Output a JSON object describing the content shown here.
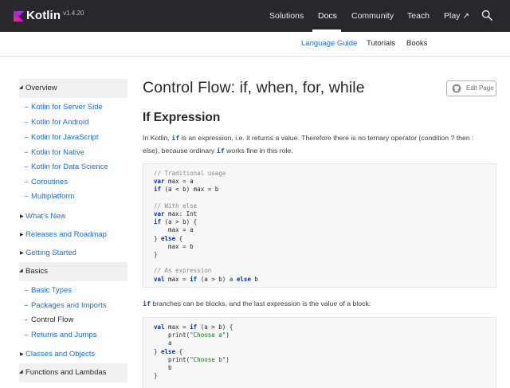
{
  "header": {
    "logo_text": "Kotlin",
    "version": "v1.4.20",
    "nav": [
      {
        "label": "Solutions"
      },
      {
        "label": "Docs"
      },
      {
        "label": "Community"
      },
      {
        "label": "Teach"
      },
      {
        "label": "Play ↗"
      }
    ],
    "active_nav": "Docs"
  },
  "subnav": {
    "items": [
      {
        "label": "Language Guide"
      },
      {
        "label": "Tutorials"
      },
      {
        "label": "Books"
      }
    ],
    "active": "Language Guide"
  },
  "sidebar": {
    "items": [
      {
        "label": "Overview"
      },
      {
        "label": "Kotlin for Server Side"
      },
      {
        "label": "Kotlin for Android"
      },
      {
        "label": "Kotlin for JavaScript"
      },
      {
        "label": "Kotlin for Native"
      },
      {
        "label": "Kotlin for Data Science"
      },
      {
        "label": "Coroutines"
      },
      {
        "label": "Multiplatform"
      },
      {
        "label": "What's New"
      },
      {
        "label": "Releases and Roadmap"
      },
      {
        "label": "Getting Started"
      },
      {
        "label": "Basics"
      },
      {
        "label": "Basic Types"
      },
      {
        "label": "Packages and Imports"
      },
      {
        "label": "Control Flow"
      },
      {
        "label": "Returns and Jumps"
      },
      {
        "label": "Classes and Objects"
      },
      {
        "label": "Functions and Lambdas"
      }
    ]
  },
  "main": {
    "title": "Control Flow: if, when, for, while",
    "edit_label": "Edit Page",
    "section_title": "If Expression",
    "intro": {
      "p1_a": "In Kotlin, ",
      "p1_code": "if",
      "p1_b": " is an expression, i.e. it returns a value. Therefore there is no ternary operator (condition ? then :",
      "p2_a": "else), because ordinary ",
      "p2_code": "if",
      "p2_b": " works fine in this role."
    },
    "blocks_para": {
      "code": "if",
      "text": " branches can be blocks, and the last expression is the value of a block:"
    }
  },
  "colors": {
    "header_bg": "#27282c",
    "link": "#1a6fd6",
    "keyword": "#0033b3",
    "string": "#067d17",
    "comment": "#8a8a8a",
    "sidebar_group_bg": "#f0f0f0"
  },
  "icons": {
    "logo": "kotlin-logo-icon",
    "search": "search-icon",
    "github": "github-icon",
    "group_arrow": "triangle-icon"
  }
}
